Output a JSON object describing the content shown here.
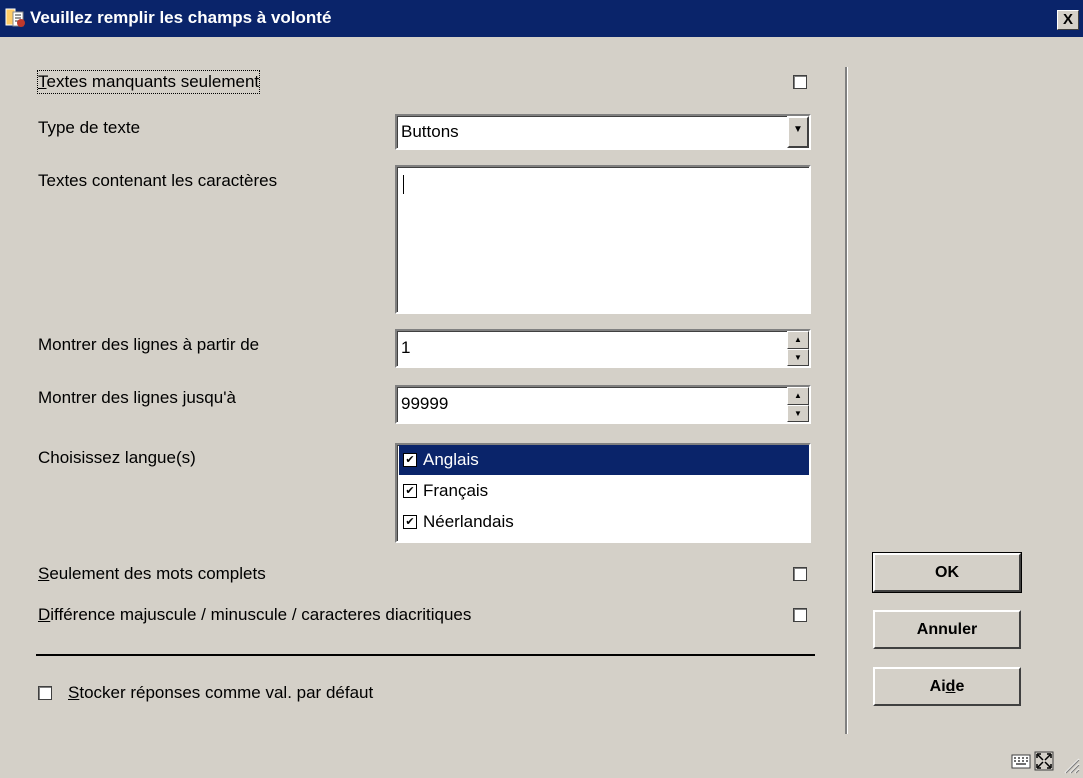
{
  "window": {
    "title": "Veuillez remplir les champs à volonté",
    "close_label": "X"
  },
  "fields": {
    "missing_only": {
      "label_ul": "T",
      "label_rest": "extes manquants seulement",
      "checked": false
    },
    "text_type": {
      "label": "Type de texte",
      "value": "Buttons"
    },
    "contains": {
      "label": "Textes contenant les caractères",
      "value": ""
    },
    "from_line": {
      "label": "Montrer des lignes à partir de",
      "value": "1"
    },
    "to_line": {
      "label": "Montrer des lignes jusqu'à",
      "value": "99999"
    },
    "languages": {
      "label": "Choisissez langue(s)",
      "items": [
        {
          "label": "Anglais",
          "checked": true,
          "selected": true
        },
        {
          "label": "Français",
          "checked": true,
          "selected": false
        },
        {
          "label": "Néerlandais",
          "checked": true,
          "selected": false
        }
      ]
    },
    "whole_words": {
      "label_ul": "S",
      "label_rest": "eulement des mots complets",
      "checked": false
    },
    "case_sensitive": {
      "label_ul": "D",
      "label_rest": "ifférence majuscule / minuscule / caracteres diacritiques",
      "checked": false
    },
    "store_defaults": {
      "label_ul": "S",
      "label_rest": "tocker réponses comme val. par défaut",
      "checked": false
    }
  },
  "buttons": {
    "ok": "OK",
    "cancel": "Annuler",
    "help_pre": "Ai",
    "help_ul": "d",
    "help_post": "e"
  },
  "icons": [
    "app-icon",
    "close-icon",
    "keyboard-icon",
    "maximize-icon",
    "resize-grip-icon"
  ]
}
